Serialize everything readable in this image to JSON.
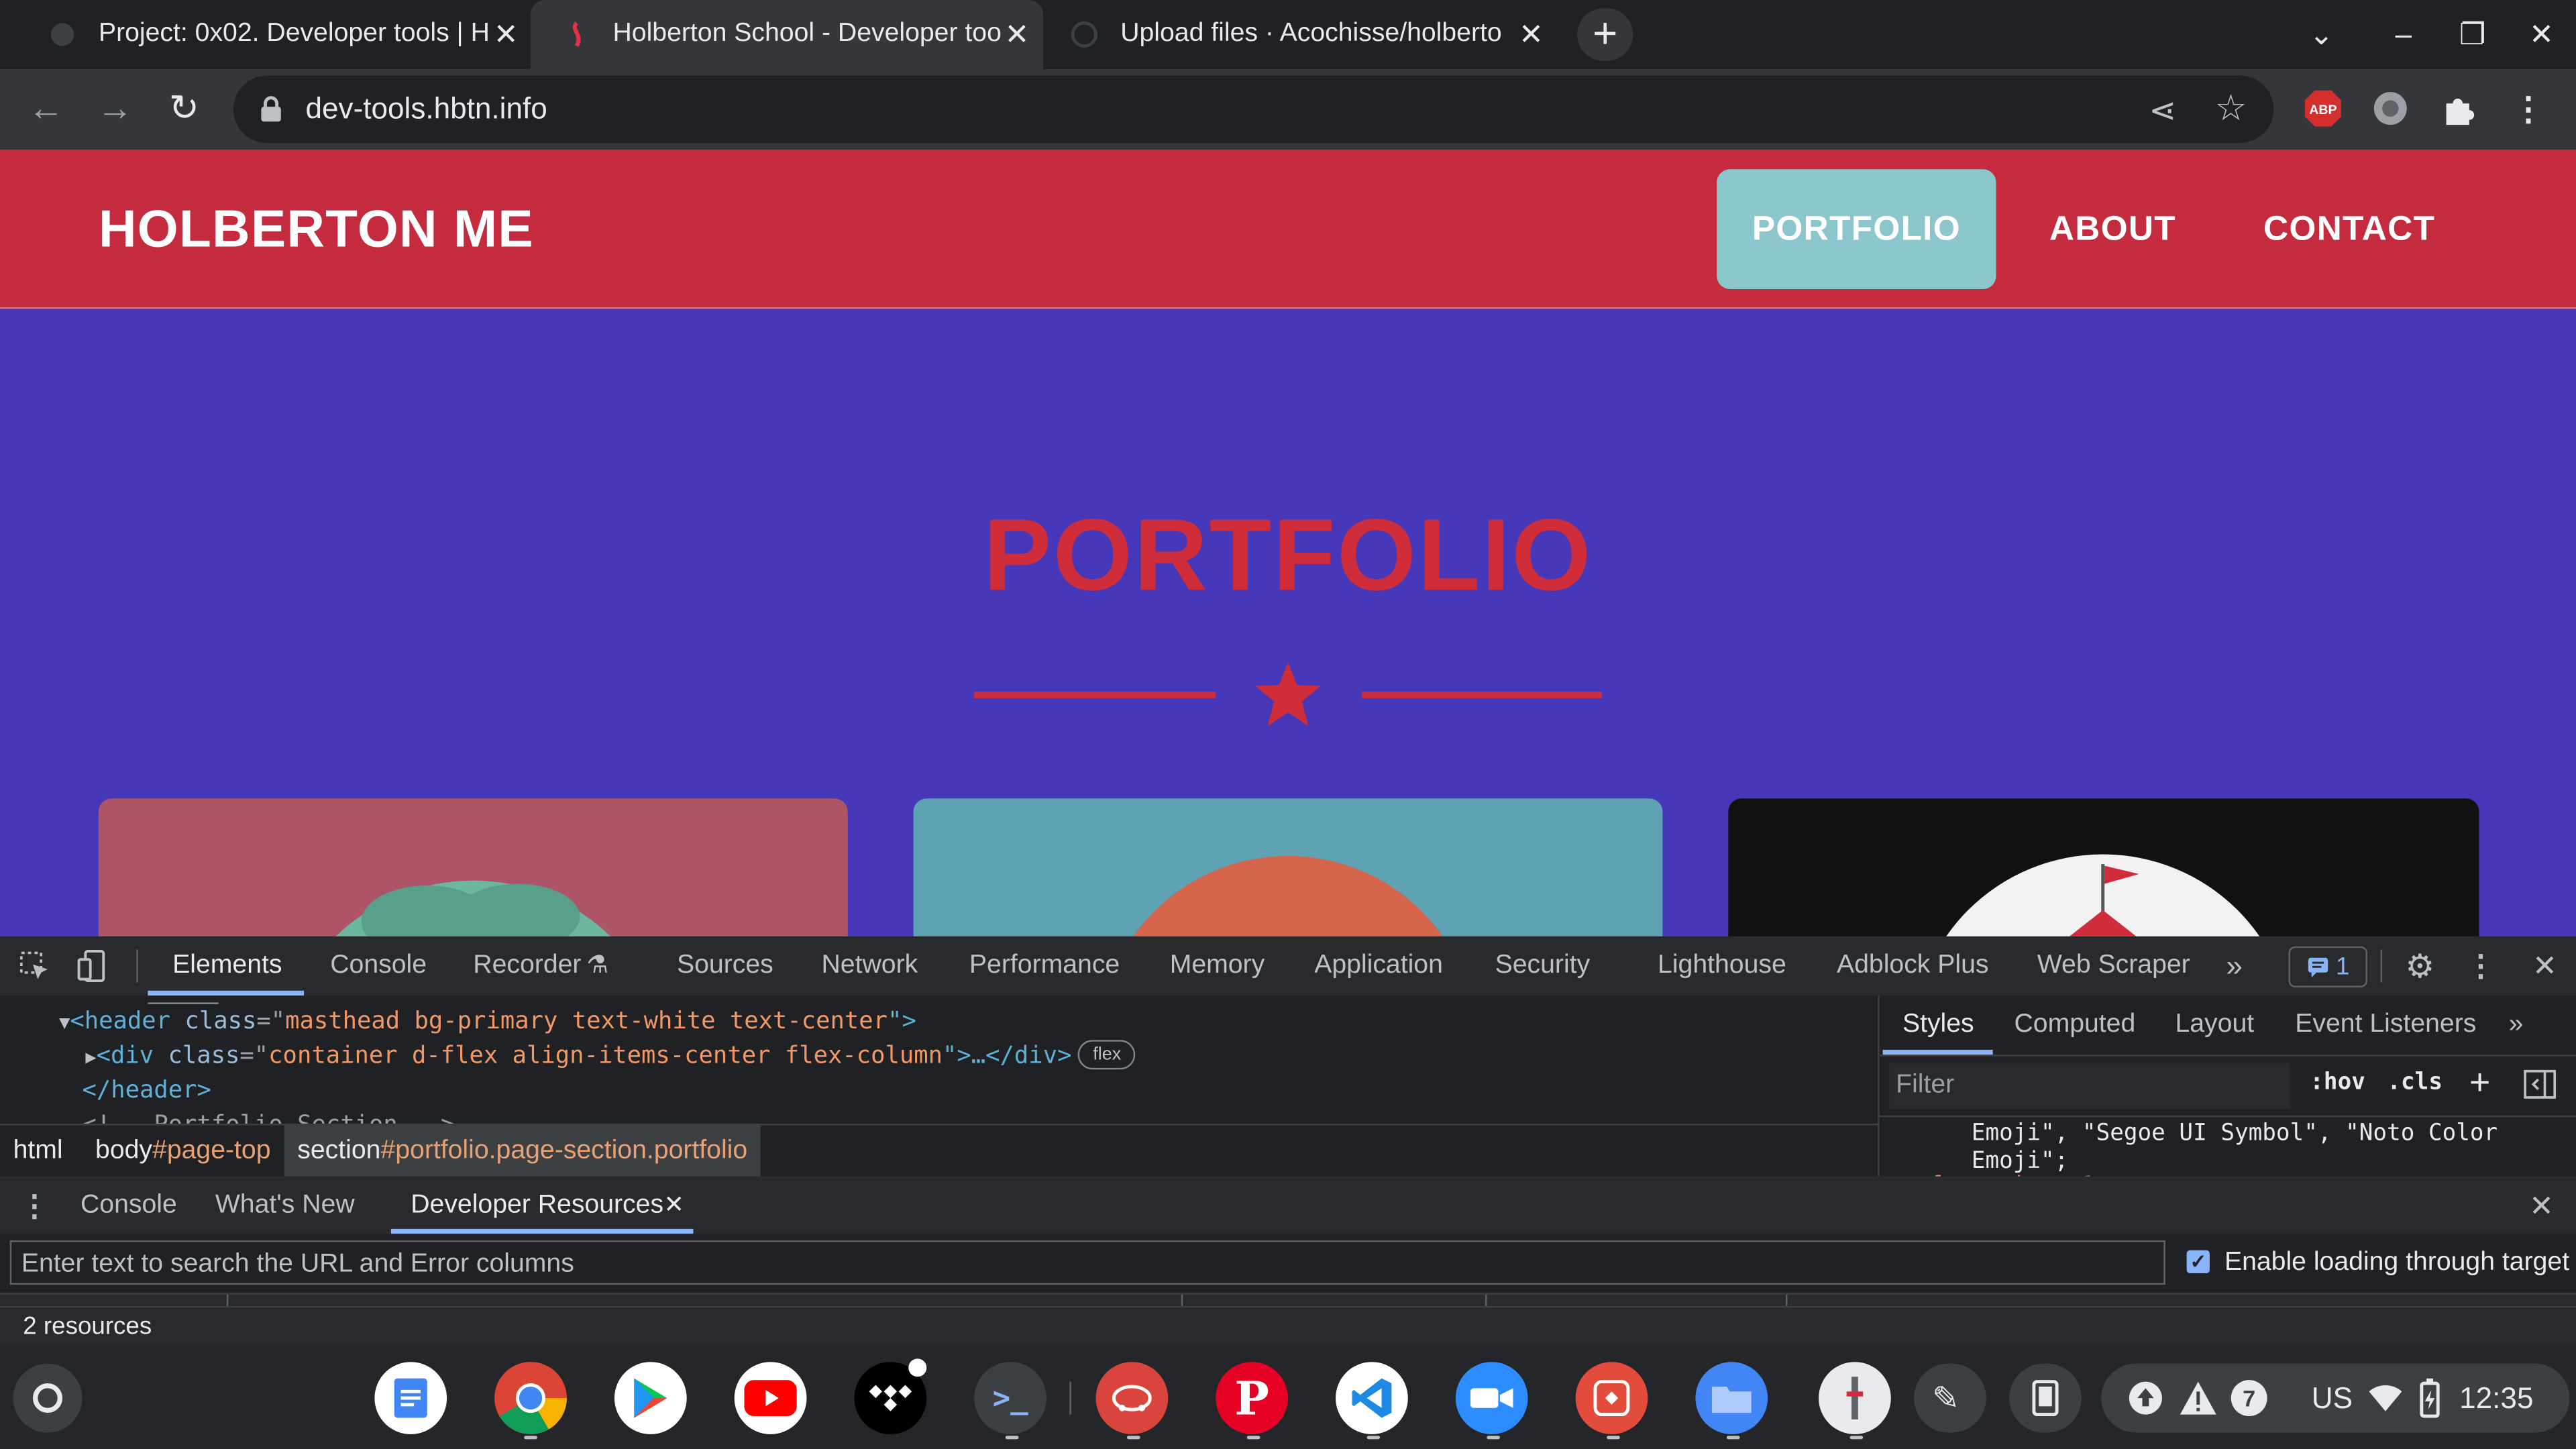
{
  "browser": {
    "tabs": [
      {
        "title": "Project: 0x02. Developer tools | H",
        "active": false
      },
      {
        "title": "Holberton School - Developer too",
        "active": true
      },
      {
        "title": "Upload files · Acochisse/holberto",
        "active": false
      }
    ],
    "url": "dev-tools.hbtn.info"
  },
  "site": {
    "brand": "HOLBERTON ME",
    "nav": [
      "PORTFOLIO",
      "ABOUT",
      "CONTACT"
    ],
    "heading": "PORTFOLIO",
    "colors": {
      "navbar": "#c42b3f",
      "background": "#4638b8",
      "accent": "#cf2d3a",
      "active_nav": "#8cc6cd"
    }
  },
  "devtools": {
    "tabs": [
      "Elements",
      "Console",
      "Recorder",
      "Sources",
      "Network",
      "Performance",
      "Memory",
      "Application",
      "Security",
      "Lighthouse",
      "Adblock Plus",
      "Web Scraper"
    ],
    "issues_count": "1",
    "elements": {
      "line1": {
        "open": "<header",
        "attr": "class",
        "eq": "=\"",
        "val": "masthead bg-primary text-white text-center",
        "close": "\">"
      },
      "line2": {
        "open": "<div",
        "attr": "class",
        "eq": "=\"",
        "val": "container d-flex align-items-center flex-column",
        "close": "\">…</div>",
        "pill": "flex"
      },
      "line3": "</header>"
    },
    "breadcrumbs": {
      "html": "html",
      "body_tag": "body",
      "body_id": "#page-top",
      "section_tag": "section",
      "section_rest": "#portfolio.page-section.portfolio"
    },
    "styles": {
      "tabs": [
        "Styles",
        "Computed",
        "Layout",
        "Event Listeners"
      ],
      "filter_placeholder": "Filter",
      "hov": ":hov",
      "cls": ".cls",
      "code1": "Emoji\", \"Segoe UI Symbol\", \"Noto Color",
      "code2": "Emoji\";"
    },
    "drawer": {
      "tabs": [
        "Console",
        "What's New",
        "Developer Resources"
      ],
      "search_placeholder": "Enter text to search the URL and Error columns",
      "checkbox_label": "Enable loading through target",
      "status": "2 resources"
    }
  },
  "shelf": {
    "apps": [
      "docs-icon",
      "chrome-icon",
      "play-store-icon",
      "youtube-icon",
      "tidal-icon",
      "terminal-icon",
      "cloud-app-icon",
      "pinterest-icon",
      "vscode-icon",
      "zoom-icon",
      "sketch-icon",
      "files-icon",
      "app-icon",
      "pen-icon",
      "phone-hub-icon"
    ],
    "tray": {
      "notif_count": "7",
      "locale": "US",
      "time": "12:35"
    }
  }
}
